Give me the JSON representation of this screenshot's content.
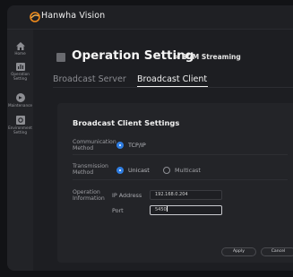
{
  "app": {
    "brand": "Hanwha Vision"
  },
  "sidebar": {
    "items": [
      {
        "label": "Home",
        "icon": "home-icon"
      },
      {
        "label": "Operation Setting",
        "icon": "operation-setting-icon"
      },
      {
        "label": "Maintenance",
        "icon": "maintenance-icon"
      },
      {
        "label": "Environment Setting",
        "icon": "environment-setting-icon"
      }
    ]
  },
  "page": {
    "title": "Operation Setting",
    "breadcrumb": "> BGM Streaming"
  },
  "tabs": [
    {
      "label": "Broadcast Server",
      "active": false
    },
    {
      "label": "Broadcast Client",
      "active": true
    }
  ],
  "settings": {
    "heading": "Broadcast Client Settings",
    "comm_label": "Communication Method",
    "comm_option": "TCP/IP",
    "transmission_label": "Transmission Method",
    "transmission_options": [
      "Unicast",
      "Multicast"
    ],
    "transmission_selected": "Unicast",
    "operation_label": "Operation Information",
    "ip_label": "IP Address",
    "ip_value": "192.168.0.204",
    "port_label": "Port",
    "port_value": "5450"
  },
  "buttons": {
    "apply": "Apply",
    "cancel": "Cancel"
  },
  "colors": {
    "accent": "#2f7de1",
    "brand_orange": "#f08a1c"
  }
}
